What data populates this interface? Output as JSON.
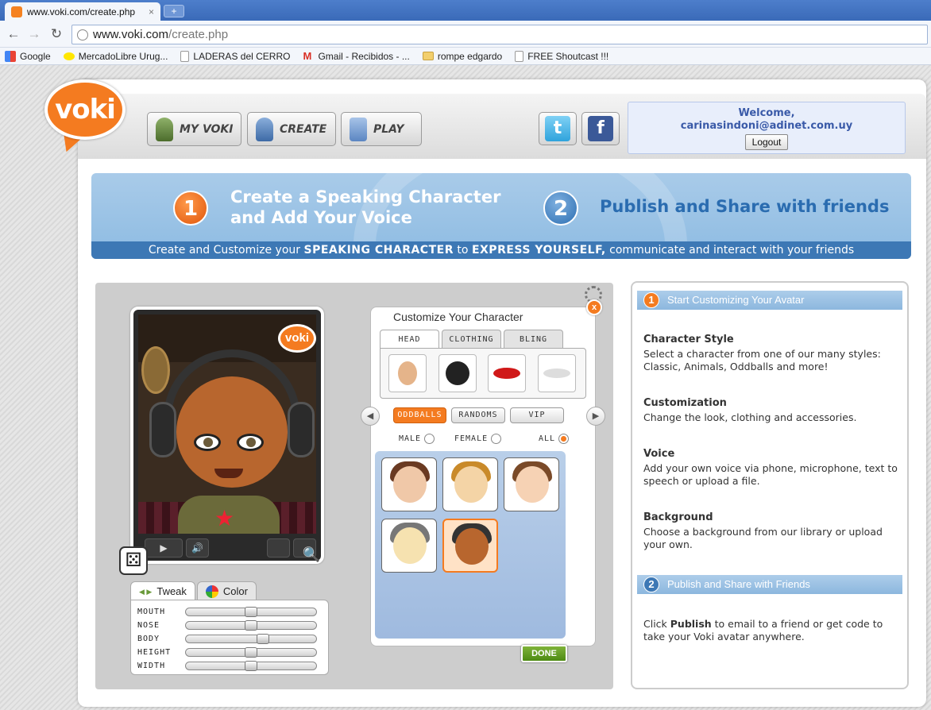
{
  "browser": {
    "tab_title": "www.voki.com/create.php",
    "tab_close": "×",
    "new_tab": "+",
    "back": "←",
    "forward": "→",
    "reload": "↻",
    "url_host": "www.voki.com",
    "url_path": "/create.php",
    "bookmarks": [
      "Google",
      "MercadoLibre Urug...",
      "LADERAS del CERRO",
      "Gmail - Recibidos - ...",
      "rompe edgardo",
      "FREE Shoutcast !!!"
    ]
  },
  "header": {
    "logo_text": "voki",
    "nav": [
      "MY VOKI",
      "CREATE",
      "PLAY"
    ],
    "twitter": "t",
    "facebook": "f",
    "welcome_line1": "Welcome,",
    "welcome_line2": "carinasindoni@adinet.com.uy",
    "logout": "Logout"
  },
  "banner": {
    "step1_num": "1",
    "step1_line1": "Create a Speaking Character",
    "step1_line2": "and Add Your Voice",
    "step2_num": "2",
    "step2_title": "Publish and Share with friends",
    "strip_pre": "Create and Customize your ",
    "strip_b1": "SPEAKING CHARACTER",
    "strip_mid": " to ",
    "strip_b2": "EXPRESS YOURSELF,",
    "strip_post": " communicate and interact with your friends"
  },
  "editor": {
    "phone_logo": "voki",
    "play": "▶",
    "volume": "🔊",
    "dice": "⚄",
    "zoom": "🔍",
    "tweak_tab": "Tweak",
    "color_tab": "Color",
    "tweak_arrows": "◀ ▶",
    "sliders": [
      {
        "label": "MOUTH",
        "value": 0.5
      },
      {
        "label": "NOSE",
        "value": 0.5
      },
      {
        "label": "BODY",
        "value": 0.6
      },
      {
        "label": "HEIGHT",
        "value": 0.5
      },
      {
        "label": "WIDTH",
        "value": 0.5
      }
    ]
  },
  "customize": {
    "title": "Customize Your Character",
    "close": "x",
    "tabs": [
      "HEAD",
      "CLOTHING",
      "BLING"
    ],
    "categories": [
      "ODDBALLS",
      "RANDOMS",
      "VIP"
    ],
    "prev": "◀",
    "next": "▶",
    "genders": [
      "MALE",
      "FEMALE",
      "ALL"
    ],
    "done": "DONE"
  },
  "sidebar": {
    "section1_num": "1",
    "section1_title": "Start Customizing Your Avatar",
    "items": [
      {
        "heading": "Character Style",
        "text": "Select a character from one of our many styles: Classic, Animals, Oddballs and more!"
      },
      {
        "heading": "Customization",
        "text": "Change the look, clothing and accessories."
      },
      {
        "heading": "Voice",
        "text": "Add your own voice via phone, microphone, text to speech or upload a file."
      },
      {
        "heading": "Background",
        "text": "Choose a background from our library or upload your own."
      }
    ],
    "section2_num": "2",
    "section2_title": "Publish and Share with Friends",
    "publish_pre": "Click ",
    "publish_bold": "Publish",
    "publish_post": " to email to a friend or get code to take your Voki avatar anywhere."
  },
  "colors": {
    "accent": "#f47b20",
    "banner_blue": "#3d78b5",
    "done_green": "#5a9a1c"
  }
}
